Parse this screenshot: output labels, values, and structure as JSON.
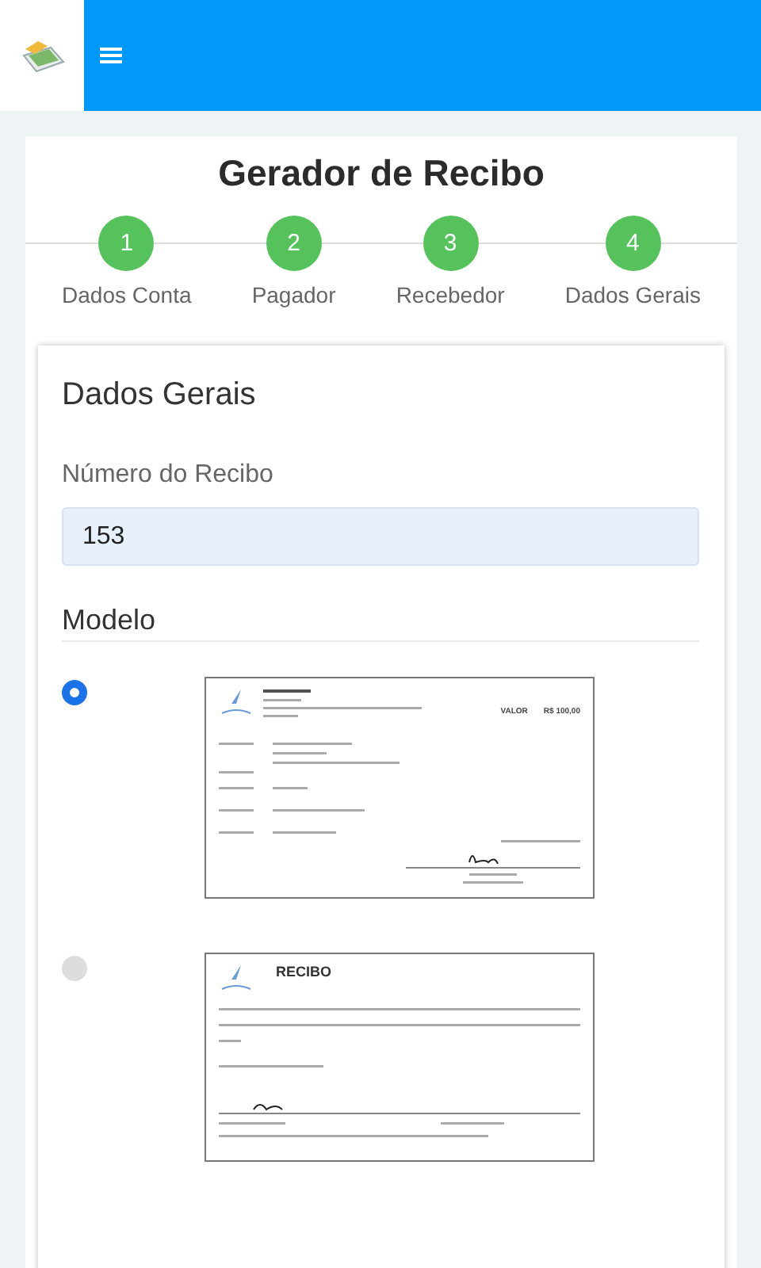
{
  "page_title": "Gerador de Recibo",
  "steps": [
    {
      "number": "1",
      "label": "Dados Conta"
    },
    {
      "number": "2",
      "label": "Pagador"
    },
    {
      "number": "3",
      "label": "Recebedor"
    },
    {
      "number": "4",
      "label": "Dados Gerais"
    }
  ],
  "section_title": "Dados Gerais",
  "receipt_number": {
    "label": "Número do Recibo",
    "value": "153"
  },
  "model": {
    "label": "Modelo",
    "options": [
      {
        "kind": "detailed",
        "selected": true,
        "texts": [
          "VALOR",
          "R$ 100,00"
        ]
      },
      {
        "kind": "simple",
        "selected": false,
        "texts": [
          "RECIBO"
        ]
      }
    ]
  }
}
